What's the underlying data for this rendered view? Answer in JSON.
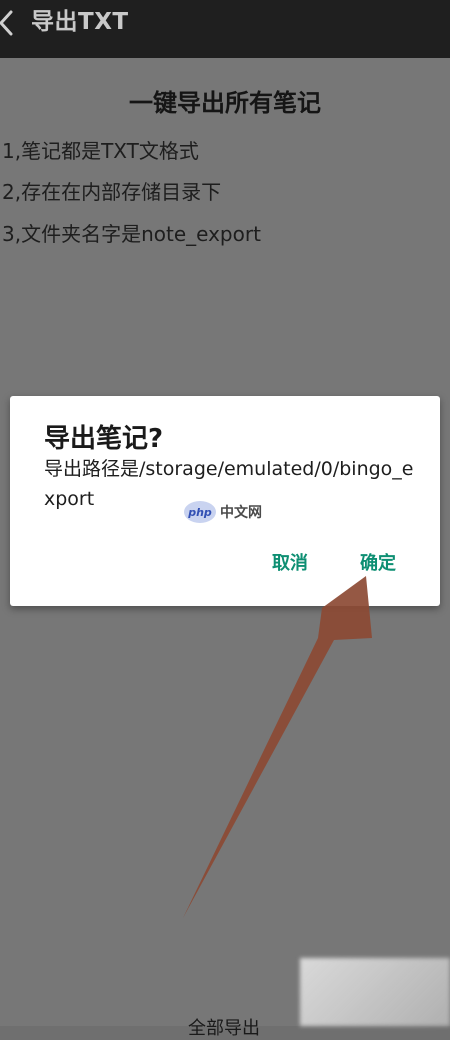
{
  "appbar": {
    "title": "导出TXT",
    "back_icon": "chevron-left-icon"
  },
  "content": {
    "title": "一键导出所有笔记",
    "rules": [
      "1,笔记都是TXT文格式",
      "2,存在在内部存储目录下",
      "3,文件夹名字是note_export"
    ],
    "bottom_button_label": "全部导出"
  },
  "dialog": {
    "title": "导出笔记?",
    "message": "导出路径是/storage/emulated/0/bingo_export",
    "cancel_label": "取消",
    "ok_label": "确定"
  },
  "watermark": {
    "logo_text": "php",
    "text": "中文网"
  },
  "colors": {
    "appbar_bg": "#1f1f1f",
    "overlay_bg": "#777777",
    "dialog_button": "#0e8f73",
    "arrow": "#8c4a34"
  }
}
